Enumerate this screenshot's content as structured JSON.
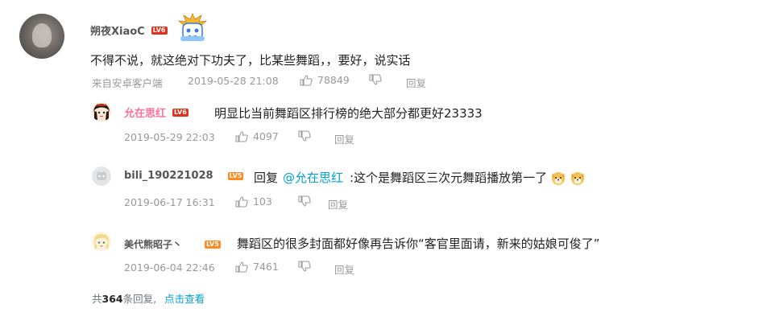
{
  "main_comment": {
    "username": "朔夜XiaoC",
    "level": "LV6",
    "content": "不得不说，就这绝对下功夫了，比某些舞蹈，，要好，说实话",
    "source": "来自安卓客户端",
    "time": "2019-05-28 21:08",
    "likes": "78849",
    "reply_label": "回复"
  },
  "replies": [
    {
      "username": "允在思红",
      "level": "LV6",
      "content": "明显比当前舞蹈区排行榜的绝大部分都更好23333",
      "time": "2019-05-29 22:03",
      "likes": "4097",
      "reply_label": "回复"
    },
    {
      "username": "bili_190221028",
      "level": "LV5",
      "reply_prefix": "回复",
      "mention": "@允在思红",
      "content": ":这个是舞蹈区三次元舞蹈播放第一了",
      "time": "2019-06-17 16:31",
      "likes": "103",
      "reply_label": "回复"
    },
    {
      "username": "美代熊昭子丶",
      "level": "LV5",
      "content": "舞蹈区的很多封面都好像再告诉你“客官里面请，新来的姑娘可俊了”",
      "time": "2019-06-04 22:46",
      "likes": "7461",
      "reply_label": "回复"
    }
  ],
  "footer": {
    "prefix": "共",
    "count": "364",
    "suffix": "条回复,",
    "view_more": "点击查看"
  },
  "colors": {
    "accent_blue": "#00a1d6",
    "vip_pink": "#fb7299",
    "lv6": "#e0311d",
    "lv5": "#ff8a1f"
  }
}
